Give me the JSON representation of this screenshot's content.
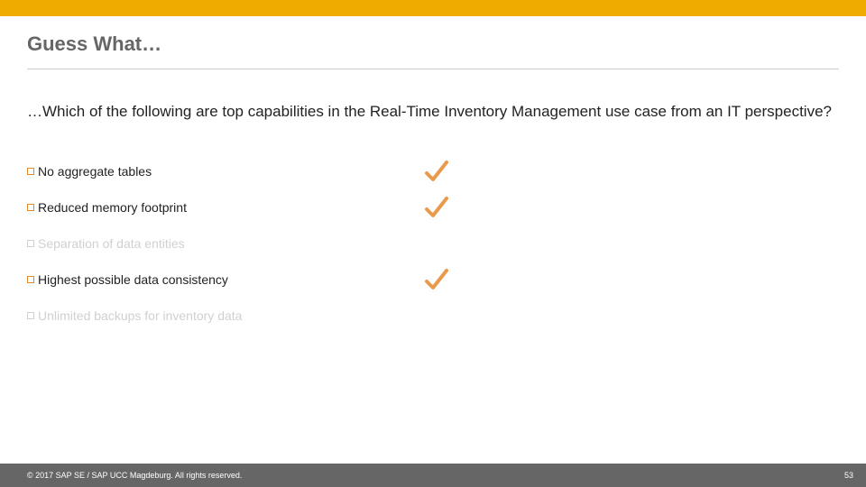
{
  "colors": {
    "accent": "#f0ab00",
    "check": "#e89a4d",
    "text": "#222222",
    "muted": "#d0d0d0",
    "footer_bg": "#666666"
  },
  "header": {
    "title": "Guess What…"
  },
  "question": "…Which of the following are top capabilities in the Real-Time Inventory Management use case from an IT perspective?",
  "options": [
    {
      "label": "No aggregate tables",
      "correct": true
    },
    {
      "label": "Reduced memory footprint",
      "correct": true
    },
    {
      "label": "Separation of data entities",
      "correct": false
    },
    {
      "label": "Highest possible data consistency",
      "correct": true
    },
    {
      "label": "Unlimited backups for inventory data",
      "correct": false
    }
  ],
  "footer": {
    "copyright": "© 2017 SAP SE / SAP UCC Magdeburg. All rights reserved.",
    "page": "53"
  }
}
